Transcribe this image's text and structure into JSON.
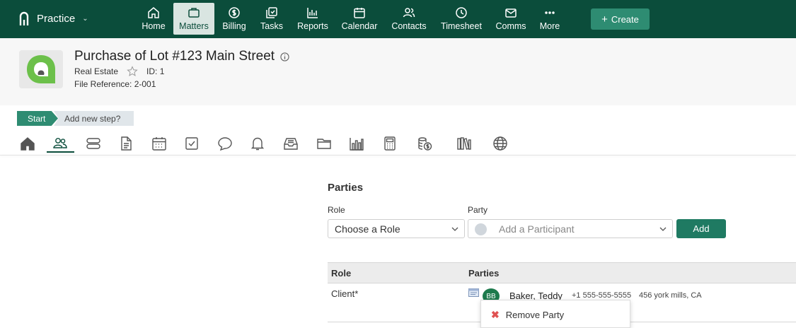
{
  "app": {
    "name": "Practice"
  },
  "nav": {
    "items": [
      {
        "label": "Home",
        "icon": "home-icon"
      },
      {
        "label": "Matters",
        "icon": "briefcase-icon",
        "active": true
      },
      {
        "label": "Billing",
        "icon": "dollar-icon"
      },
      {
        "label": "Tasks",
        "icon": "tasks-icon"
      },
      {
        "label": "Reports",
        "icon": "bar-chart-icon"
      },
      {
        "label": "Calendar",
        "icon": "calendar-icon"
      },
      {
        "label": "Contacts",
        "icon": "contacts-icon"
      },
      {
        "label": "Timesheet",
        "icon": "clock-icon"
      },
      {
        "label": "Comms",
        "icon": "mail-icon"
      },
      {
        "label": "More",
        "icon": "more-icon"
      }
    ],
    "create_label": "Create"
  },
  "matter": {
    "title": "Purchase of Lot #123 Main Street",
    "type": "Real Estate",
    "id_label": "ID: 1",
    "file_reference": "File Reference: 2-001"
  },
  "workflow": {
    "start": "Start",
    "add_step": "Add new step?"
  },
  "toolbar_icons": [
    "home-icon",
    "people-icon",
    "layers-icon",
    "document-icon",
    "calendar-icon",
    "checkbox-icon",
    "chat-icon",
    "bell-icon",
    "inbox-icon",
    "folder-icon",
    "bar-chart-icon",
    "calculator-icon",
    "coins-icon",
    "library-icon",
    "globe-icon"
  ],
  "parties": {
    "title": "Parties",
    "role_label": "Role",
    "party_label": "Party",
    "role_placeholder": "Choose a Role",
    "party_placeholder": "Add a Participant",
    "add_label": "Add",
    "table": {
      "headers": [
        "Role",
        "Parties"
      ],
      "rows": [
        {
          "role": "Client*",
          "initials": "BB",
          "name": "Baker, Teddy",
          "phone": "+1 555-555-5555",
          "address": "456 york mills, CA"
        }
      ]
    },
    "context_menu": {
      "remove_label": "Remove Party"
    }
  },
  "colors": {
    "nav_bg": "#0b4d3b",
    "accent": "#2e8c72",
    "badge": "#1d7a4c",
    "danger": "#e05252"
  }
}
